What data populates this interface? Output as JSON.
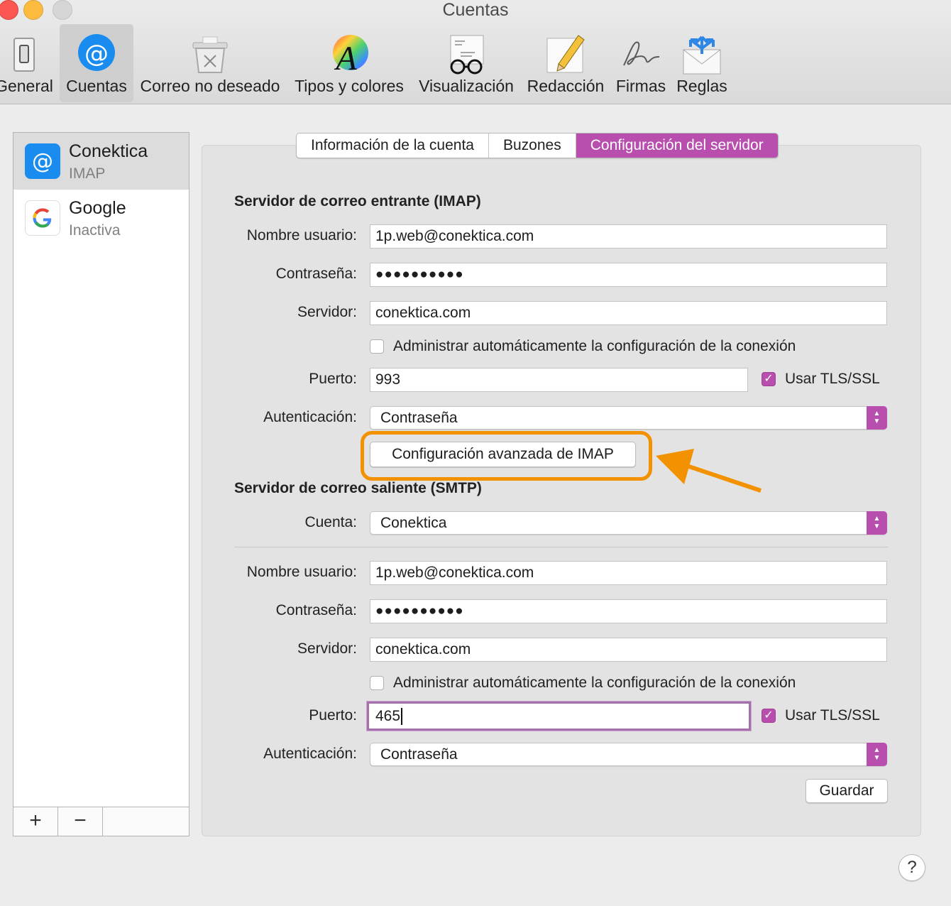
{
  "window": {
    "title": "Cuentas"
  },
  "toolbar": {
    "items": [
      {
        "label": "General",
        "icon": "switch-icon"
      },
      {
        "label": "Cuentas",
        "icon": "at-sign-icon"
      },
      {
        "label": "Correo no deseado",
        "icon": "trash-bin-icon"
      },
      {
        "label": "Tipos y colores",
        "icon": "font-color-wheel-icon"
      },
      {
        "label": "Visualización",
        "icon": "glasses-letter-icon"
      },
      {
        "label": "Redacción",
        "icon": "pencil-pad-icon"
      },
      {
        "label": "Firmas",
        "icon": "signature-icon"
      },
      {
        "label": "Reglas",
        "icon": "envelope-arrows-icon"
      }
    ],
    "selected": "Cuentas"
  },
  "sidebar": {
    "accounts": [
      {
        "name": "Conektica",
        "type": "IMAP"
      },
      {
        "name": "Google",
        "type": "Inactiva"
      }
    ],
    "add_label": "+",
    "remove_label": "−"
  },
  "tabs": [
    {
      "label": "Información de la cuenta"
    },
    {
      "label": "Buzones"
    },
    {
      "label": "Configuración del servidor"
    }
  ],
  "incoming": {
    "title": "Servidor de correo entrante (IMAP)",
    "username_label": "Nombre usuario:",
    "username": "1p.web@conektica.com",
    "password_label": "Contraseña:",
    "password": "●●●●●●●●●●",
    "server_label": "Servidor:",
    "server": "conektica.com",
    "auto_manage_label": "Administrar automáticamente la configuración de la conexión",
    "auto_manage": false,
    "port_label": "Puerto:",
    "port": "993",
    "tls_label": "Usar TLS/SSL",
    "tls": true,
    "auth_label": "Autenticación:",
    "auth": "Contraseña",
    "advanced_button": "Configuración avanzada de IMAP"
  },
  "outgoing": {
    "title": "Servidor de correo saliente (SMTP)",
    "account_label": "Cuenta:",
    "account": "Conektica",
    "username_label": "Nombre usuario:",
    "username": "1p.web@conektica.com",
    "password_label": "Contraseña:",
    "password": "●●●●●●●●●●",
    "server_label": "Servidor:",
    "server": "conektica.com",
    "auto_manage_label": "Administrar automáticamente la configuración de la conexión",
    "auto_manage": false,
    "port_label": "Puerto:",
    "port": "465",
    "tls_label": "Usar TLS/SSL",
    "tls": true,
    "auth_label": "Autenticación:",
    "auth": "Contraseña"
  },
  "save_button": "Guardar",
  "help_button": "?",
  "colors": {
    "accent": "#b84fae",
    "highlight": "#f39200",
    "mail_blue": "#1a8cf0"
  }
}
